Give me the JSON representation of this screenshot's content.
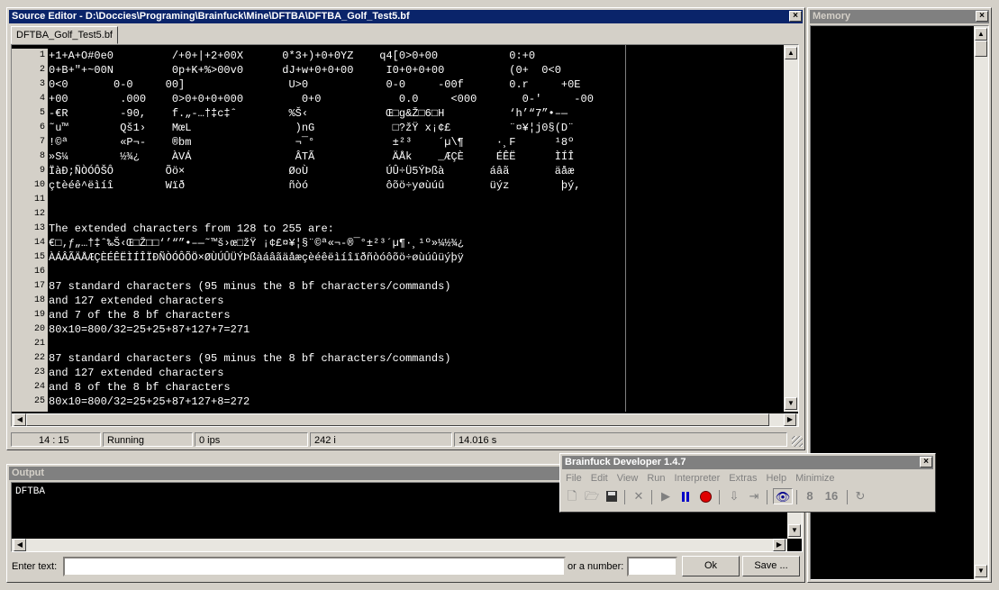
{
  "editor": {
    "title": "Source Editor - D:\\Doccies\\Programing\\Brainfuck\\Mine\\DFTBA\\DFTBA_Golf_Test5.bf",
    "tab": "DFTBA_Golf_Test5.bf",
    "lines": [
      {
        "n": "1",
        "t": "+1+A+O#0e0         /+0+|+2+00X      0*3+)+0+0YZ    q4[0>0+00           0:+0"
      },
      {
        "n": "2",
        "t": "0+B+\"+~00N         0p+K+%>00v0      dJ+w+0+0+00     I0+0+0+00          (0+  0<0"
      },
      {
        "n": "3",
        "t": "0<0       0-0     00]                U>0            0-0     -00f       0.r     +0E"
      },
      {
        "n": "4",
        "t": "+00        .000    0>0+0+0+000         0+0            0.0     <000       0-'     -00"
      },
      {
        "n": "5",
        "t": "-€R        -90,    f.„-…†‡c‡ˆ        %Š‹            Œ□g&Ž□6□H          ‘h’“7”•–—"
      },
      {
        "n": "6",
        "t": "˜u™        Qš1›    MœL                )nG            □?žŸ x¡¢£         ¨¤¥¦j0§(D¨"
      },
      {
        "n": "7",
        "t": "!©ª        «P¬-    ®bm                ¬¯°            ±²³    ´µ\\¶     ·¸F      ¹8º"
      },
      {
        "n": "8",
        "t": "»S¼        ½¾¿     ÀVÁ                ÂTÃ            ÄÅk    _ÆÇÈ     ÉÊË      ÌÍÎ"
      },
      {
        "n": "9",
        "t": "ÏàĐ;ÑÒÓÔŠÔ        Õö×                ØoÙ            ÚÛ÷Ü5ÝÞßà       áâã       äåæ"
      },
      {
        "n": "10",
        "t": "çtèéê^ëìíî        Wïð                ñòó            ôõö÷yøùúû       üýz        þý,"
      },
      {
        "n": "11",
        "t": ""
      },
      {
        "n": "12",
        "t": ""
      },
      {
        "n": "13",
        "t": "The extended characters from 128 to 255 are:"
      },
      {
        "n": "14",
        "t": "€□‚ƒ„…†‡ˆ‰Š‹Œ□Ž□□‘’“”•–—˜™š›œ□žŸ ¡¢£¤¥¦§¨©ª«¬-®¯°±²³´µ¶·¸¹º»¼½¾¿"
      },
      {
        "n": "15",
        "t": "ÀÁÂÃÄÅÆÇÈÉÊËÌÍÎÏÐÑÒÓÔÕÖ×ØÙÚÛÜÝÞßàáâãäåæçèéêëìíîïðñòóôõö÷øùúûüýþÿ"
      },
      {
        "n": "16",
        "t": ""
      },
      {
        "n": "17",
        "t": "87 standard characters (95 minus the 8 bf characters/commands)"
      },
      {
        "n": "18",
        "t": "and 127 extended characters"
      },
      {
        "n": "19",
        "t": "and 7 of the 8 bf characters"
      },
      {
        "n": "20",
        "t": "80x10=800/32=25+25+87+127+7=271"
      },
      {
        "n": "21",
        "t": ""
      },
      {
        "n": "22",
        "t": "87 standard characters (95 minus the 8 bf characters/commands)"
      },
      {
        "n": "23",
        "t": "and 127 extended characters"
      },
      {
        "n": "24",
        "t": "and 8 of the 8 bf characters"
      },
      {
        "n": "25",
        "t": "80x10=800/32=25+25+87+127+8=272"
      }
    ],
    "status": {
      "position": "14 : 15",
      "state": "Running",
      "speed": "0 ips",
      "instructions": "242 i",
      "time": "14.016 s"
    }
  },
  "memory": {
    "title": "Memory"
  },
  "output": {
    "title": "Output",
    "text": "DFTBA",
    "enter_text_label": "Enter text:",
    "enter_text_value": "",
    "number_label": "or a number:",
    "number_value": "",
    "ok_label": "Ok",
    "save_label": "Save ..."
  },
  "devwin": {
    "title": "Brainfuck Developer 1.4.7",
    "menu": [
      "File",
      "Edit",
      "View",
      "Run",
      "Interpreter",
      "Extras",
      "Help",
      "Minimize"
    ],
    "toolbar_icons": [
      "new-file-icon",
      "open-folder-icon",
      "save-icon",
      "stop-icon",
      "play-icon",
      "pause-icon",
      "record-icon",
      "step-icon",
      "step-over-icon",
      "watch-eye-icon",
      "8-bit-icon",
      "16-bit-icon",
      "wrap-icon"
    ]
  },
  "colors": {
    "active_title": "#0a246a",
    "inactive_title": "#808080",
    "editor_bg": "#000000",
    "editor_fg": "#ffffff"
  }
}
